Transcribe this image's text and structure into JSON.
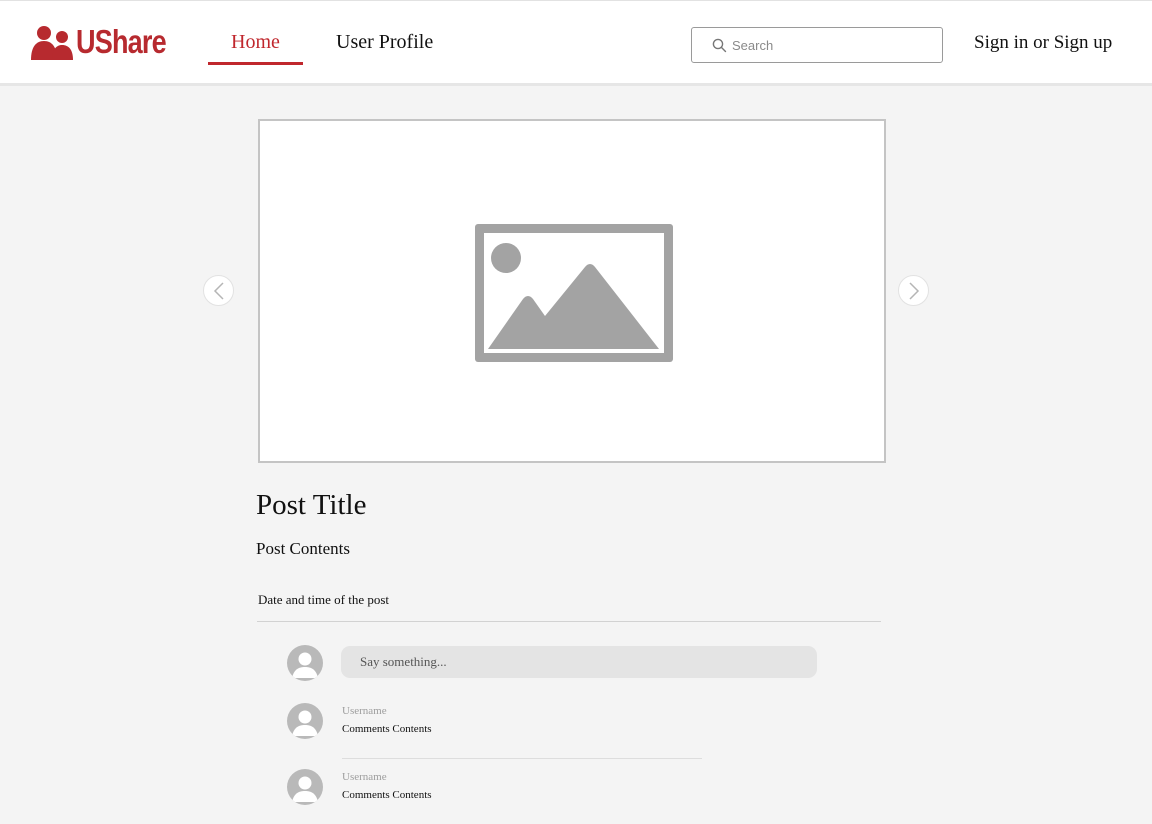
{
  "header": {
    "logo_text": "UShare",
    "nav": {
      "home": "Home",
      "profile": "User Profile"
    },
    "search": {
      "placeholder": "Search"
    },
    "signin": "Sign in or Sign up"
  },
  "post": {
    "title": "Post Title",
    "contents": "Post Contents",
    "datetime": "Date and time of the post"
  },
  "comment_box": {
    "placeholder": "Say something..."
  },
  "comments": [
    {
      "username": "Username",
      "text": "Comments Contents"
    },
    {
      "username": "Username",
      "text": "Comments Contents"
    }
  ],
  "colors": {
    "brand": "#b72a2f",
    "active_nav": "#c0272d",
    "placeholder_gray": "#a3a3a3",
    "avatar_gray": "#b9b9b9"
  }
}
